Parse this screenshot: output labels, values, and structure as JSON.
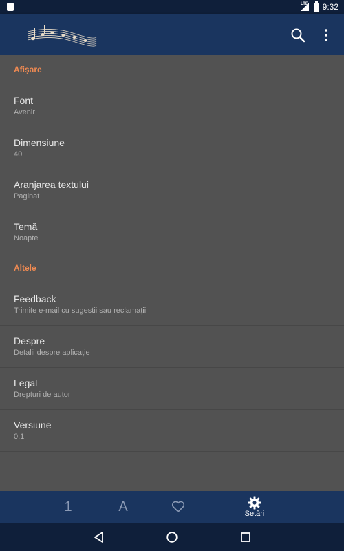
{
  "status_bar": {
    "network": "LTE",
    "time": "9:32"
  },
  "app_bar": {
    "logo_icon": "music-notes-logo",
    "actions": [
      "search-icon",
      "more-vert-icon"
    ]
  },
  "sections": [
    {
      "header": "Afișare",
      "items": [
        {
          "title": "Font",
          "summary": "Avenir"
        },
        {
          "title": "Dimensiune",
          "summary": "40"
        },
        {
          "title": "Aranjarea textului",
          "summary": "Paginat"
        },
        {
          "title": "Temă",
          "summary": "Noapte"
        }
      ]
    },
    {
      "header": "Altele",
      "items": [
        {
          "title": "Feedback",
          "summary": "Trimite e-mail cu sugestii sau reclamații"
        },
        {
          "title": "Despre",
          "summary": "Detalii despre aplicație"
        },
        {
          "title": "Legal",
          "summary": "Drepturi de autor"
        },
        {
          "title": "Versiune",
          "summary": "0.1"
        }
      ]
    }
  ],
  "bottom_nav": {
    "tabs": [
      {
        "glyph": "1"
      },
      {
        "glyph": "A"
      },
      {
        "icon": "heart-outline-icon"
      },
      {
        "icon": "gear-icon",
        "label": "Setări",
        "active": true
      }
    ]
  },
  "system_nav": [
    "back-icon",
    "home-icon",
    "recents-icon"
  ],
  "colors": {
    "accent": "#ef8a52",
    "app_bar": "#1a355f",
    "status_bar": "#0f1f3a",
    "background": "#525252"
  }
}
